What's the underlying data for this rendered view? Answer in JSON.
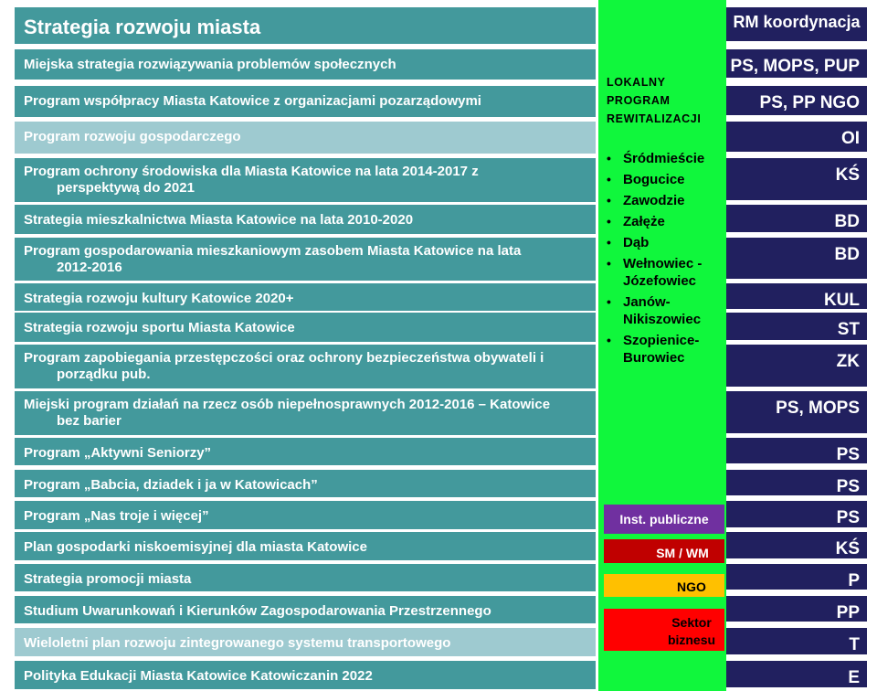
{
  "colors": {
    "row_dark": "#43999c",
    "row_light": "#9ecad0",
    "code_bg": "#21205f",
    "green": "#10f73c",
    "legend_inst": "#7030a0",
    "legend_sm": "#c00000",
    "legend_ngo": "#ffc000",
    "legend_sektor": "#ff0000"
  },
  "header": {
    "title": "Strategia rozwoju miasta",
    "code": "RM koordynacja"
  },
  "rows": [
    {
      "line1": "Miejska strategia rozwiązywania problemów społecznych",
      "line2": "",
      "code": "PS, MOPS, PUP",
      "light": false
    },
    {
      "line1": "Program współpracy Miasta Katowice z organizacjami pozarządowymi",
      "line2": "",
      "code": "PS, PP NGO",
      "light": false
    },
    {
      "line1": "Program rozwoju gospodarczego",
      "line2": "",
      "code": "OI",
      "light": true
    },
    {
      "line1": "Program ochrony środowiska dla Miasta Katowice na lata 2014-2017 z",
      "line2": "perspektywą do 2021",
      "code": "KŚ",
      "light": false
    },
    {
      "line1": "Strategia mieszkalnictwa Miasta Katowice na lata 2010-2020",
      "line2": "",
      "code": "BD",
      "light": false
    },
    {
      "line1": "Program gospodarowania mieszkaniowym zasobem Miasta Katowice na lata",
      "line2": "2012-2016",
      "code": "BD",
      "light": false
    },
    {
      "line1": "Strategia rozwoju kultury Katowice 2020+",
      "line2": "",
      "code": "KUL",
      "light": false
    },
    {
      "line1": "Strategia rozwoju sportu Miasta Katowice",
      "line2": "",
      "code": "ST",
      "light": false
    },
    {
      "line1": "Program zapobiegania przestępczości oraz ochrony bezpieczeństwa obywateli i",
      "line2": "porządku pub.",
      "code": "ZK",
      "light": false
    },
    {
      "line1": "Miejski program działań na rzecz osób niepełnosprawnych 2012-2016 – Katowice",
      "line2": "bez barier",
      "code": "PS, MOPS",
      "light": false
    },
    {
      "line1": "Program „Aktywni Seniorzy”",
      "line2": "",
      "code": "PS",
      "light": false
    },
    {
      "line1": "Program „Babcia, dziadek i ja w Katowicach”",
      "line2": "",
      "code": "PS",
      "light": false
    },
    {
      "line1": "Program „Nas troje i więcej”",
      "line2": "",
      "code": "PS",
      "light": false
    },
    {
      "line1": "Plan gospodarki niskoemisyjnej dla miasta Katowice",
      "line2": "",
      "code": "KŚ",
      "light": false
    },
    {
      "line1": "Strategia promocji miasta",
      "line2": "",
      "code": "P",
      "light": false
    },
    {
      "line1": "Studium Uwarunkowań i Kierunków Zagospodarowania Przestrzennego",
      "line2": "",
      "code": "PP",
      "light": false
    },
    {
      "line1": "Wieloletni plan rozwoju zintegrowanego systemu transportowego",
      "line2": "",
      "code": "T",
      "light": true
    },
    {
      "line1": "Polityka Edukacji Miasta Katowice Katowiczanin 2022",
      "line2": "",
      "code": "E",
      "light": false
    }
  ],
  "lpr": {
    "line1": "LOKALNY",
    "line2": "PROGRAM",
    "line3": "REWITALIZACJI"
  },
  "districts": [
    {
      "name": "Śródmieście"
    },
    {
      "name": "Bogucice"
    },
    {
      "name": "Zawodzie"
    },
    {
      "name": "Załęże"
    },
    {
      "name": "Dąb"
    },
    {
      "name": "Wełnowiec - Józefowiec"
    },
    {
      "name": "Janów-Nikiszowiec"
    },
    {
      "name": "Szopienice-Burowiec"
    }
  ],
  "legend": {
    "inst": "Inst. publiczne",
    "sm": "SM / WM",
    "ngo": "NGO",
    "sektor_line1": "Sektor",
    "sektor_line2": "biznesu"
  }
}
